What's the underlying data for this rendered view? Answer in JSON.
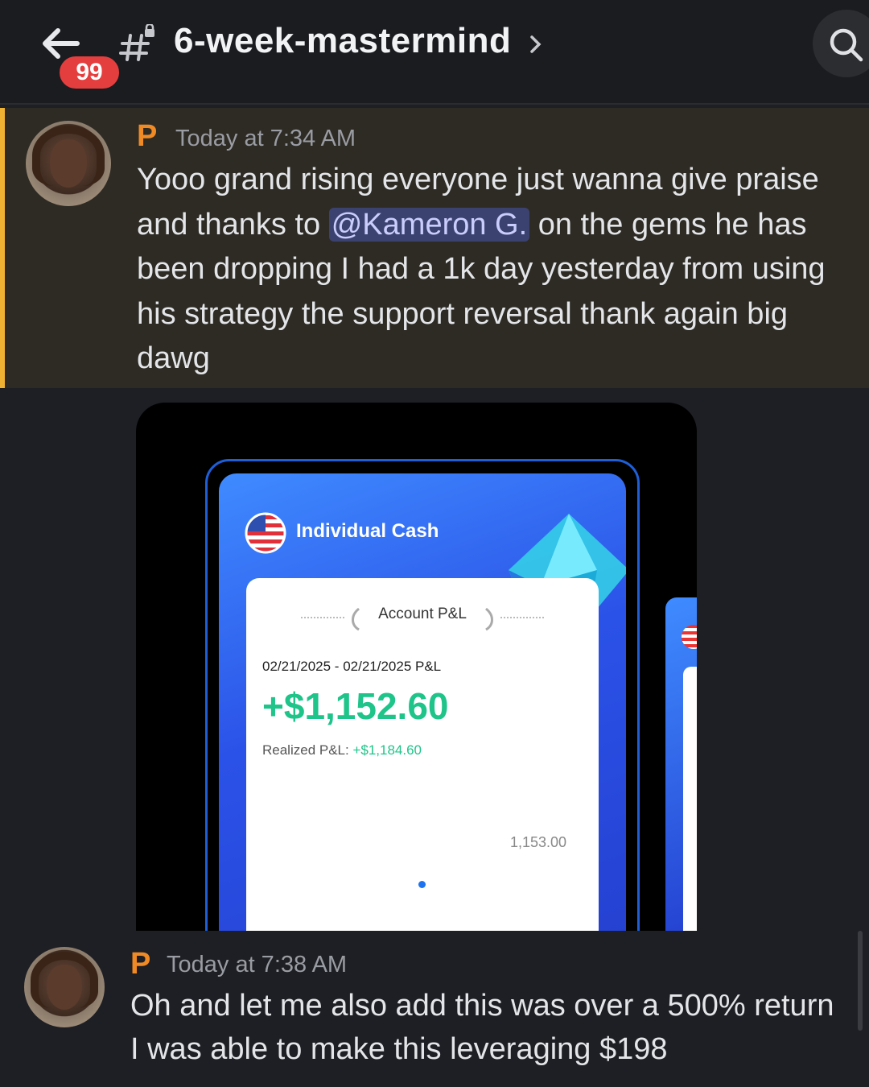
{
  "header": {
    "back_icon": "arrow-left-icon",
    "unread_count": "99",
    "channel_icon": "hashtag-lock-icon",
    "channel_name": "6-week-mastermind",
    "chevron": "›",
    "search_icon": "search-icon"
  },
  "messages": [
    {
      "author": "P",
      "timestamp": "Today at 7:34 AM",
      "text_before": "Yooo grand rising everyone just wanna give praise and thanks to ",
      "mention": "@Kameron G.",
      "text_after": " on the gems he has been dropping I had a 1k day yesterday from using his strategy the support reversal thank again big dawg",
      "highlight_color": "#f0b232"
    },
    {
      "author": "P",
      "timestamp": "Today at 7:38 AM",
      "text": "Oh and let me also add this was over a 500% return I was able to make this leveraging $198"
    }
  ],
  "attachment": {
    "account_label": "Individual Cash",
    "pnl_heading": "Account P&L",
    "date_range": "02/21/2025 - 02/21/2025 P&L",
    "pnl_value": "+$1,152.60",
    "realized_label": "Realized P&L: ",
    "realized_value": "+$1,184.60",
    "chart_tick": "1,153.00",
    "accent_green": "#1ec48a"
  },
  "colors": {
    "author": "#f08a24",
    "mention_bg": "#3c4270"
  }
}
